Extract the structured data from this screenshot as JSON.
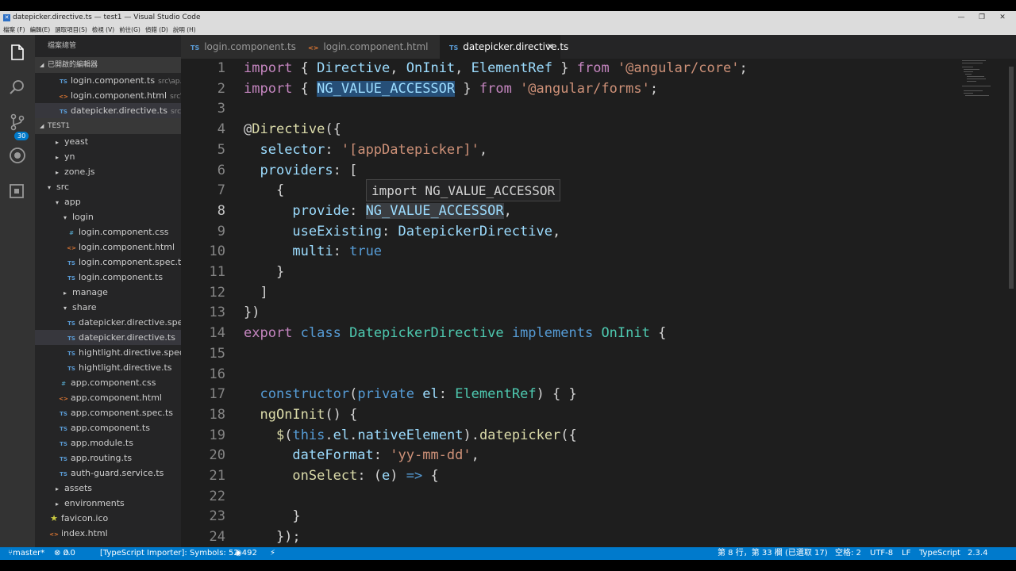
{
  "window": {
    "title": "datepicker.directive.ts — test1 — Visual Studio Code",
    "icon": "vscode-icon"
  },
  "menu": [
    "檔案 (F)",
    "編輯(E)",
    "選取項目(S)",
    "檢視 (V)",
    "前往(G)",
    "偵錯 (D)",
    "說明 (H)"
  ],
  "window_controls": [
    "minimize-icon",
    "restore-icon",
    "close-icon"
  ],
  "activity": {
    "icons": [
      "files-icon",
      "search-icon",
      "source-control-icon",
      "debug-icon",
      "extensions-icon"
    ],
    "scm_badge": "30"
  },
  "sidebar": {
    "header": "檔案總管",
    "open_editors_title": "已開啟的編輯器",
    "open_editors": [
      {
        "icon": "TS",
        "name": "login.component.ts",
        "desc": "src\\ap..."
      },
      {
        "icon": "<>",
        "name": "login.component.html",
        "desc": "src\\..."
      },
      {
        "icon": "TS",
        "name": "datepicker.directive.ts",
        "desc": "src\\..."
      }
    ],
    "folder_title": "TEST1",
    "tree": [
      {
        "name": "yeast",
        "icon": "▸"
      },
      {
        "name": "yn",
        "icon": "▸"
      },
      {
        "name": "zone.js",
        "icon": "▸"
      },
      {
        "name": "src",
        "icon": "▾"
      },
      {
        "name": "app",
        "icon": "▾"
      },
      {
        "name": "login",
        "icon": "▾"
      },
      {
        "name": "login.component.css",
        "icon": "#"
      },
      {
        "name": "login.component.html",
        "icon": "<>"
      },
      {
        "name": "login.component.spec.ts",
        "icon": "TS"
      },
      {
        "name": "login.component.ts",
        "icon": "TS"
      },
      {
        "name": "manage",
        "icon": "▸"
      },
      {
        "name": "share",
        "icon": "▾"
      },
      {
        "name": "datepicker.directive.spe...",
        "icon": "TS"
      },
      {
        "name": "datepicker.directive.ts",
        "icon": "TS"
      },
      {
        "name": "hightlight.directive.spec...",
        "icon": "TS"
      },
      {
        "name": "hightlight.directive.ts",
        "icon": "TS"
      },
      {
        "name": "app.component.css",
        "icon": "#"
      },
      {
        "name": "app.component.html",
        "icon": "<>"
      },
      {
        "name": "app.component.spec.ts",
        "icon": "TS"
      },
      {
        "name": "app.component.ts",
        "icon": "TS"
      },
      {
        "name": "app.module.ts",
        "icon": "TS"
      },
      {
        "name": "app.routing.ts",
        "icon": "TS"
      },
      {
        "name": "auth-guard.service.ts",
        "icon": "TS"
      },
      {
        "name": "assets",
        "icon": "▸"
      },
      {
        "name": "environments",
        "icon": "▸"
      },
      {
        "name": "favicon.ico",
        "icon": "★"
      },
      {
        "name": "index.html",
        "icon": "<>"
      }
    ]
  },
  "tabs": [
    {
      "icon": "TS",
      "label": "login.component.ts"
    },
    {
      "icon": "<>",
      "label": "login.component.html"
    },
    {
      "icon": "TS",
      "label": "datepicker.directive.ts",
      "close": "✕"
    }
  ],
  "editor": {
    "line_numbers": [
      "1",
      "2",
      "3",
      "4",
      "5",
      "6",
      "7",
      "8",
      "9",
      "10",
      "11",
      "12",
      "13",
      "14",
      "15",
      "16",
      "17",
      "18",
      "19",
      "20",
      "21",
      "22",
      "23",
      "24"
    ],
    "tooltip": "import NG_VALUE_ACCESSOR",
    "lines": [
      [
        [
          "kw",
          "import"
        ],
        [
          "pl",
          " { "
        ],
        [
          "id",
          "Directive"
        ],
        [
          "pl",
          ", "
        ],
        [
          "id",
          "OnInit"
        ],
        [
          "pl",
          ", "
        ],
        [
          "id",
          "ElementRef"
        ],
        [
          "pl",
          " } "
        ],
        [
          "kw",
          "from"
        ],
        [
          "pl",
          " "
        ],
        [
          "st",
          "'@angular/core'"
        ],
        [
          "pl",
          ";"
        ]
      ],
      [
        [
          "kw",
          "import"
        ],
        [
          "pl",
          " { "
        ],
        [
          "idhl",
          "NG_VALUE_ACCESSOR"
        ],
        [
          "pl",
          " } "
        ],
        [
          "kw",
          "from"
        ],
        [
          "pl",
          " "
        ],
        [
          "st",
          "'@angular/forms'"
        ],
        [
          "pl",
          ";"
        ]
      ],
      [],
      [
        [
          "pl",
          "@"
        ],
        [
          "fn",
          "Directive"
        ],
        [
          "pl",
          "({"
        ]
      ],
      [
        [
          "pl",
          "  "
        ],
        [
          "id",
          "selector"
        ],
        [
          "pl",
          ": "
        ],
        [
          "st",
          "'[appDatepicker]'"
        ],
        [
          "pl",
          ","
        ]
      ],
      [
        [
          "pl",
          "  "
        ],
        [
          "id",
          "providers"
        ],
        [
          "pl",
          ": ["
        ]
      ],
      [
        [
          "pl",
          "    {"
        ]
      ],
      [
        [
          "pl",
          "      "
        ],
        [
          "id",
          "provide"
        ],
        [
          "pl",
          ": "
        ],
        [
          "idhl2",
          "NG_VALUE_ACCESSOR"
        ],
        [
          "pl",
          ","
        ]
      ],
      [
        [
          "pl",
          "      "
        ],
        [
          "id",
          "useExisting"
        ],
        [
          "pl",
          ": "
        ],
        [
          "id",
          "DatepickerDirective"
        ],
        [
          "pl",
          ","
        ]
      ],
      [
        [
          "pl",
          "      "
        ],
        [
          "id",
          "multi"
        ],
        [
          "pl",
          ": "
        ],
        [
          "k2",
          "true"
        ]
      ],
      [
        [
          "pl",
          "    }"
        ]
      ],
      [
        [
          "pl",
          "  ]"
        ]
      ],
      [
        [
          "pl",
          "})"
        ]
      ],
      [
        [
          "kw",
          "export"
        ],
        [
          "pl",
          " "
        ],
        [
          "k2",
          "class"
        ],
        [
          "pl",
          " "
        ],
        [
          "ty",
          "DatepickerDirective"
        ],
        [
          "pl",
          " "
        ],
        [
          "k2",
          "implements"
        ],
        [
          "pl",
          " "
        ],
        [
          "ty",
          "OnInit"
        ],
        [
          "pl",
          " {"
        ]
      ],
      [],
      [],
      [
        [
          "pl",
          "  "
        ],
        [
          "k2",
          "constructor"
        ],
        [
          "pl",
          "("
        ],
        [
          "k2",
          "private"
        ],
        [
          "pl",
          " "
        ],
        [
          "id",
          "el"
        ],
        [
          "pl",
          ": "
        ],
        [
          "ty",
          "ElementRef"
        ],
        [
          "pl",
          ") { }"
        ]
      ],
      [
        [
          "pl",
          "  "
        ],
        [
          "fn",
          "ngOnInit"
        ],
        [
          "pl",
          "() {"
        ]
      ],
      [
        [
          "pl",
          "    "
        ],
        [
          "fn",
          "$"
        ],
        [
          "pl",
          "("
        ],
        [
          "k2",
          "this"
        ],
        [
          "pl",
          "."
        ],
        [
          "id",
          "el"
        ],
        [
          "pl",
          "."
        ],
        [
          "id",
          "nativeElement"
        ],
        [
          "pl",
          ")."
        ],
        [
          "fn",
          "datepicker"
        ],
        [
          "pl",
          "({"
        ]
      ],
      [
        [
          "pl",
          "      "
        ],
        [
          "id",
          "dateFormat"
        ],
        [
          "pl",
          ": "
        ],
        [
          "st",
          "'yy-mm-dd'"
        ],
        [
          "pl",
          ","
        ]
      ],
      [
        [
          "pl",
          "      "
        ],
        [
          "fn",
          "onSelect"
        ],
        [
          "pl",
          ": ("
        ],
        [
          "id",
          "e"
        ],
        [
          "pl",
          ") "
        ],
        [
          "k2",
          "=>"
        ],
        [
          "pl",
          " {"
        ]
      ],
      [],
      [
        [
          "pl",
          "      }"
        ]
      ],
      [
        [
          "pl",
          "    });"
        ]
      ]
    ]
  },
  "status": {
    "branch": "master*",
    "errors": "0",
    "warnings": "0",
    "importer": "[TypeScript Importer]: Symbols: 52",
    "eye_count": "492",
    "position": "第 8 行，第 33 欄 (已選取 17)",
    "spaces": "空格: 2",
    "encoding": "UTF-8",
    "eol": "LF",
    "language": "TypeScript",
    "version": "2.3.4"
  }
}
